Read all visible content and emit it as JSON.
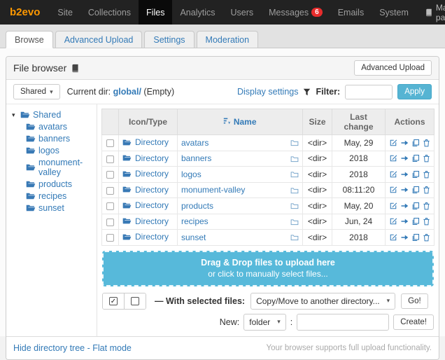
{
  "nav": {
    "brand": "b2evo",
    "items": [
      {
        "label": "Site"
      },
      {
        "label": "Collections"
      },
      {
        "label": "Files",
        "active": true
      },
      {
        "label": "Analytics"
      },
      {
        "label": "Users"
      },
      {
        "label": "Messages",
        "badge": "6"
      },
      {
        "label": "Emails"
      },
      {
        "label": "System"
      }
    ],
    "manual_page": "Manual page"
  },
  "tabs": [
    {
      "label": "Browse",
      "active": true
    },
    {
      "label": "Advanced Upload"
    },
    {
      "label": "Settings"
    },
    {
      "label": "Moderation"
    }
  ],
  "panel": {
    "title": "File browser",
    "advanced_upload_button": "Advanced Upload"
  },
  "toolbar": {
    "root_button": "Shared",
    "current_dir_label": "Current dir:",
    "current_dir": "global/",
    "current_dir_suffix": "(Empty)",
    "display_settings_link": "Display settings",
    "filter_label": "Filter:",
    "filter_value": "",
    "apply_button": "Apply"
  },
  "tree": {
    "root": "Shared",
    "items": [
      "avatars",
      "banners",
      "logos",
      "monument-valley",
      "products",
      "recipes",
      "sunset"
    ]
  },
  "table": {
    "headers": {
      "icon_type": "Icon/Type",
      "name": "Name",
      "size": "Size",
      "last_change": "Last change",
      "actions": "Actions"
    },
    "rows": [
      {
        "type": "Directory",
        "name": "avatars",
        "size": "<dir>",
        "last_change": "May, 29"
      },
      {
        "type": "Directory",
        "name": "banners",
        "size": "<dir>",
        "last_change": "2018"
      },
      {
        "type": "Directory",
        "name": "logos",
        "size": "<dir>",
        "last_change": "2018"
      },
      {
        "type": "Directory",
        "name": "monument-valley",
        "size": "<dir>",
        "last_change": "08:11:20"
      },
      {
        "type": "Directory",
        "name": "products",
        "size": "<dir>",
        "last_change": "May, 20"
      },
      {
        "type": "Directory",
        "name": "recipes",
        "size": "<dir>",
        "last_change": "Jun, 24"
      },
      {
        "type": "Directory",
        "name": "sunset",
        "size": "<dir>",
        "last_change": "2018"
      }
    ]
  },
  "dropzone": {
    "line1": "Drag & Drop files to upload here",
    "line2": "or click to manually select files..."
  },
  "selection": {
    "with_selected_label": "— With selected files:",
    "action_select_value": "Copy/Move to another directory...",
    "go_button": "Go!"
  },
  "create": {
    "new_label": "New:",
    "type_select_value": "folder",
    "separator": ":",
    "create_button": "Create!"
  },
  "footer": {
    "hide_tree_link": "Hide directory tree",
    "separator": "-",
    "flat_mode_link": "Flat mode",
    "upload_support_text": "Your browser supports full upload functionality."
  },
  "colors": {
    "brand_orange": "#ff9900",
    "link_blue": "#337ab7",
    "folder_blue": "#3879b5",
    "info_cyan": "#56b4d3",
    "badge_red": "#e82c2c",
    "navbar_bg": "#222222",
    "dropzone_bg": "#57b9da"
  }
}
